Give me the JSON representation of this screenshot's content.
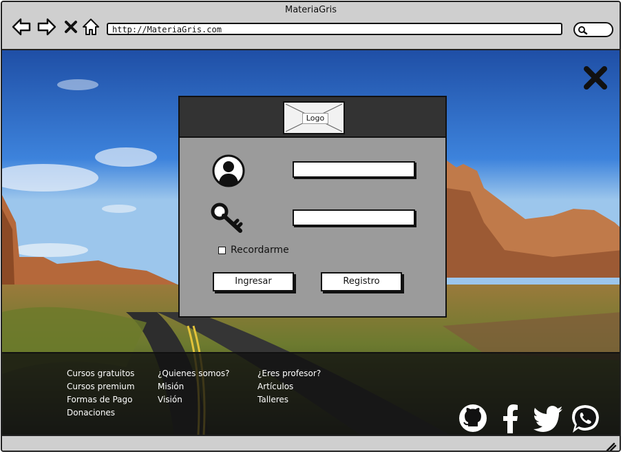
{
  "window": {
    "title": "MateriaGris",
    "url": "http://MateriaGris.com",
    "nav_icons": [
      "back-arrow-icon",
      "forward-arrow-icon",
      "stop-x-icon",
      "home-icon"
    ],
    "search_icon": "search-icon"
  },
  "page": {
    "background": "desert-road-landscape",
    "close_icon": "close-icon"
  },
  "login": {
    "logo_label": "Logo",
    "user_icon": "user-icon",
    "password_icon": "key-icon",
    "username_value": "",
    "password_value": "",
    "remember_label": "Recordarme",
    "remember_checked": false,
    "login_button": "Ingresar",
    "register_button": "Registro"
  },
  "footer": {
    "col1": [
      "Cursos gratuitos",
      "Cursos premium",
      "Formas de Pago",
      "Donaciones"
    ],
    "col2": [
      "¿Quienes somos?",
      "Misión",
      "Visión"
    ],
    "col3": [
      "¿Eres profesor?",
      "Artículos",
      "Talleres"
    ],
    "social": [
      "github-icon",
      "facebook-icon",
      "twitter-icon",
      "whatsapp-icon"
    ]
  },
  "colors": {
    "modal_header": "#333333",
    "modal_body": "#9b9b9b",
    "chrome": "#cfcfcf",
    "footer_text": "#ffffff"
  }
}
